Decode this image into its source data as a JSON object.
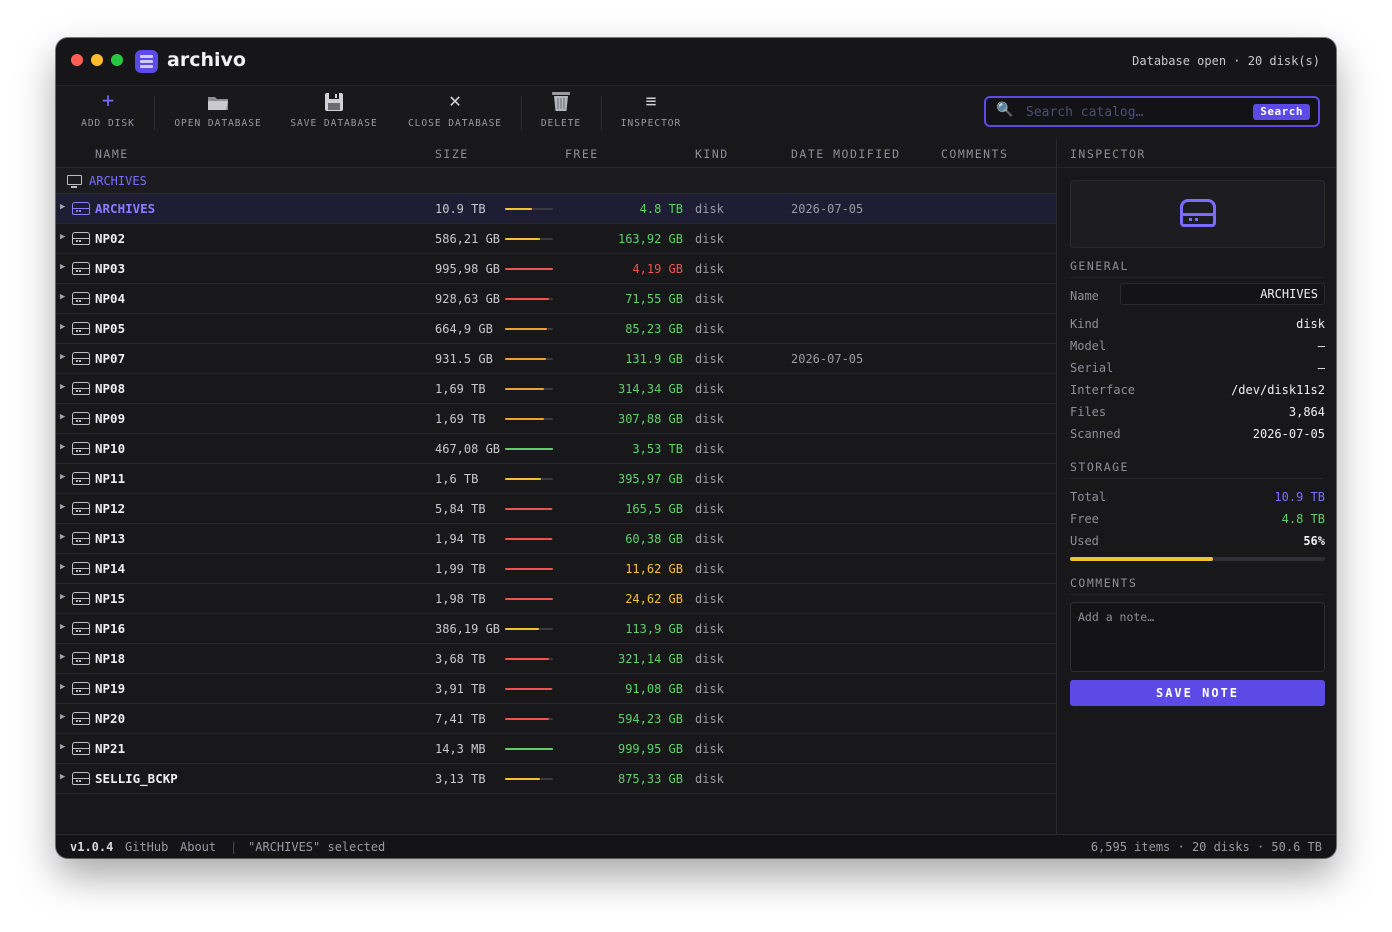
{
  "app": {
    "name": "archivo",
    "status": "Database open · 20 disk(s)"
  },
  "toolbar": {
    "add_disk": "ADD DISK",
    "open_database": "OPEN DATABASE",
    "save_database": "SAVE DATABASE",
    "close_database": "CLOSE DATABASE",
    "delete": "DELETE",
    "inspector": "INSPECTOR"
  },
  "search": {
    "placeholder": "Search catalog…",
    "button": "Search"
  },
  "columns": {
    "name": "NAME",
    "size": "SIZE",
    "free": "FREE",
    "kind": "KIND",
    "date_modified": "DATE MODIFIED",
    "comments": "COMMENTS"
  },
  "group": {
    "label": "ARCHIVES"
  },
  "colors": {
    "accent": "#5b4ae6",
    "green": "#5fd068",
    "orange": "#f0a030",
    "yellow": "#f2c230",
    "red": "#ef5350"
  },
  "disks": [
    {
      "name": "ARCHIVES",
      "size": "10.9 TB",
      "used_pct": 56,
      "bar_color": "#f2c230",
      "free": "4.8 TB",
      "free_color": "#5fd068",
      "kind": "disk",
      "date": "2026-07-05",
      "selected": true
    },
    {
      "name": "NP02",
      "size": "586,21 GB",
      "used_pct": 72,
      "bar_color": "#f2c230",
      "free": "163,92 GB",
      "free_color": "#5fd068",
      "kind": "disk",
      "date": ""
    },
    {
      "name": "NP03",
      "size": "995,98 GB",
      "used_pct": 99,
      "bar_color": "#ef5350",
      "free": "4,19 GB",
      "free_color": "#ef5350",
      "kind": "disk",
      "date": ""
    },
    {
      "name": "NP04",
      "size": "928,63 GB",
      "used_pct": 92,
      "bar_color": "#ef5350",
      "free": "71,55 GB",
      "free_color": "#5fd068",
      "kind": "disk",
      "date": ""
    },
    {
      "name": "NP05",
      "size": "664,9 GB",
      "used_pct": 87,
      "bar_color": "#f0a030",
      "free": "85,23 GB",
      "free_color": "#5fd068",
      "kind": "disk",
      "date": ""
    },
    {
      "name": "NP07",
      "size": "931.5 GB",
      "used_pct": 86,
      "bar_color": "#f0a030",
      "free": "131.9 GB",
      "free_color": "#5fd068",
      "kind": "disk",
      "date": "2026-07-05"
    },
    {
      "name": "NP08",
      "size": "1,69 TB",
      "used_pct": 81,
      "bar_color": "#f0a030",
      "free": "314,34 GB",
      "free_color": "#5fd068",
      "kind": "disk",
      "date": ""
    },
    {
      "name": "NP09",
      "size": "1,69 TB",
      "used_pct": 82,
      "bar_color": "#f0a030",
      "free": "307,88 GB",
      "free_color": "#5fd068",
      "kind": "disk",
      "date": ""
    },
    {
      "name": "NP10",
      "size": "467,08 GB",
      "used_pct": 100,
      "bar_color": "#5fd068",
      "free": "3,53 TB",
      "free_color": "#5fd068",
      "kind": "disk",
      "date": ""
    },
    {
      "name": "NP11",
      "size": "1,6 TB",
      "used_pct": 75,
      "bar_color": "#f2c230",
      "free": "395,97 GB",
      "free_color": "#5fd068",
      "kind": "disk",
      "date": ""
    },
    {
      "name": "NP12",
      "size": "5,84 TB",
      "used_pct": 97,
      "bar_color": "#ef5350",
      "free": "165,5 GB",
      "free_color": "#5fd068",
      "kind": "disk",
      "date": ""
    },
    {
      "name": "NP13",
      "size": "1,94 TB",
      "used_pct": 97,
      "bar_color": "#ef5350",
      "free": "60,38 GB",
      "free_color": "#5fd068",
      "kind": "disk",
      "date": ""
    },
    {
      "name": "NP14",
      "size": "1,99 TB",
      "used_pct": 99,
      "bar_color": "#ef5350",
      "free": "11,62 GB",
      "free_color": "#f2c230",
      "kind": "disk",
      "date": ""
    },
    {
      "name": "NP15",
      "size": "1,98 TB",
      "used_pct": 99,
      "bar_color": "#ef5350",
      "free": "24,62 GB",
      "free_color": "#f2c230",
      "kind": "disk",
      "date": ""
    },
    {
      "name": "NP16",
      "size": "386,19 GB",
      "used_pct": 70,
      "bar_color": "#f2c230",
      "free": "113,9 GB",
      "free_color": "#5fd068",
      "kind": "disk",
      "date": ""
    },
    {
      "name": "NP18",
      "size": "3,68 TB",
      "used_pct": 92,
      "bar_color": "#ef5350",
      "free": "321,14 GB",
      "free_color": "#5fd068",
      "kind": "disk",
      "date": ""
    },
    {
      "name": "NP19",
      "size": "3,91 TB",
      "used_pct": 98,
      "bar_color": "#ef5350",
      "free": "91,08 GB",
      "free_color": "#5fd068",
      "kind": "disk",
      "date": ""
    },
    {
      "name": "NP20",
      "size": "7,41 TB",
      "used_pct": 92,
      "bar_color": "#ef5350",
      "free": "594,23 GB",
      "free_color": "#5fd068",
      "kind": "disk",
      "date": ""
    },
    {
      "name": "NP21",
      "size": "14,3 MB",
      "used_pct": 100,
      "bar_color": "#5fd068",
      "free": "999,95 GB",
      "free_color": "#5fd068",
      "kind": "disk",
      "date": ""
    },
    {
      "name": "SELLIG_BCKP",
      "size": "3,13 TB",
      "used_pct": 73,
      "bar_color": "#f2c230",
      "free": "875,33 GB",
      "free_color": "#5fd068",
      "kind": "disk",
      "date": ""
    }
  ],
  "inspector": {
    "title": "INSPECTOR",
    "general_title": "GENERAL",
    "name_label": "Name",
    "name_value": "ARCHIVES",
    "kind_label": "Kind",
    "kind_value": "disk",
    "model_label": "Model",
    "model_value": "—",
    "serial_label": "Serial",
    "serial_value": "—",
    "interface_label": "Interface",
    "interface_value": "/dev/disk11s2",
    "files_label": "Files",
    "files_value": "3,864",
    "scanned_label": "Scanned",
    "scanned_value": "2026-07-05",
    "storage_title": "STORAGE",
    "total_label": "Total",
    "total_value": "10.9 TB",
    "free_label": "Free",
    "free_value": "4.8 TB",
    "used_label": "Used",
    "used_value": "56%",
    "used_fraction": 0.56,
    "comments_title": "COMMENTS",
    "note_placeholder": "Add a note…",
    "save_note": "SAVE NOTE"
  },
  "statusbar": {
    "version": "v1.0.4",
    "github": "GitHub",
    "about": "About",
    "separator": "|",
    "selection": "\"ARCHIVES\" selected",
    "summary": "6,595 items · 20 disks · 50.6 TB"
  }
}
